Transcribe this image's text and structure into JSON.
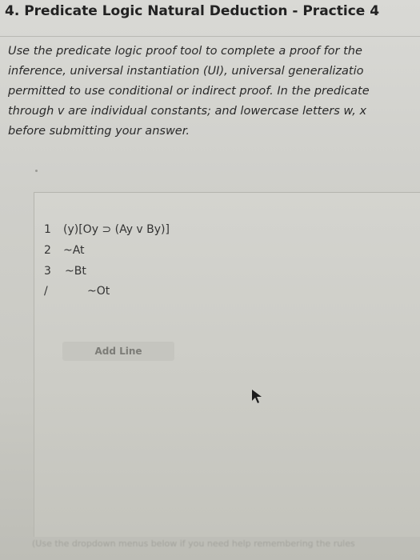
{
  "header": {
    "title": "4. Predicate Logic Natural Deduction - Practice 4"
  },
  "instructions": {
    "lines": [
      "Use the predicate logic proof tool to complete a proof for the",
      "inference, universal instantiation (UI), universal generalizatio",
      "permitted to use conditional or indirect proof. In the predicate",
      "through v are individual constants; and lowercase letters w, x",
      "before submitting your answer."
    ]
  },
  "proof": {
    "rows": [
      {
        "num": "1",
        "formula": "(y)[Oy ⊃ (Ay v By)]"
      },
      {
        "num": "2",
        "formula": "~At"
      },
      {
        "num": "3",
        "formula": "~Bt"
      },
      {
        "num": "/",
        "formula": "~Ot"
      }
    ],
    "add_line_label": "Add Line"
  },
  "footer": {
    "hint": "(Use the dropdown menus below if you need help remembering the rules"
  },
  "icons": {
    "cursor": "mouse-pointer-icon"
  }
}
